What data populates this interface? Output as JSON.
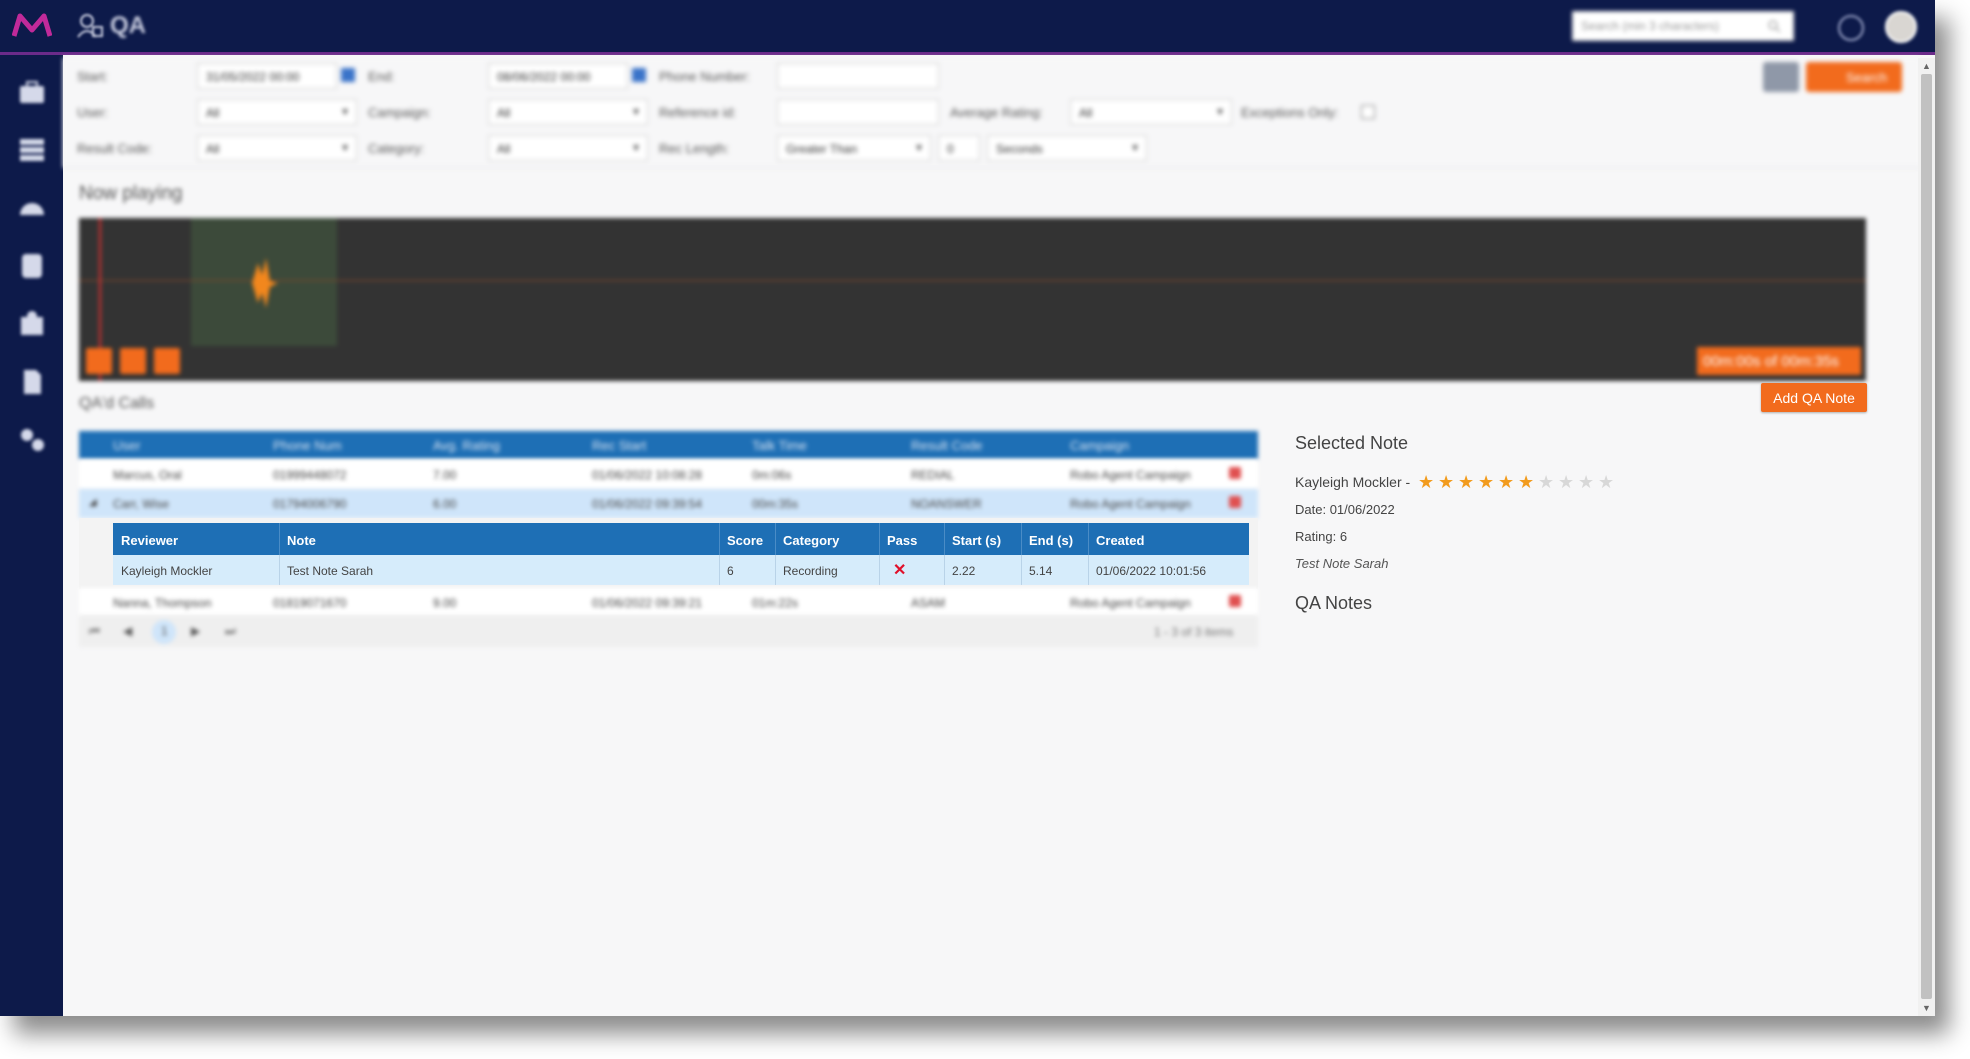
{
  "app": {
    "title": "QA"
  },
  "header": {
    "search_placeholder": "Search (min 3 characters)"
  },
  "sidebar": {
    "icons": [
      "briefcase-icon",
      "grid-icon",
      "dashboard-icon",
      "database-icon",
      "contacts-icon",
      "document-icon",
      "settings-icon"
    ]
  },
  "filters": {
    "start_label": "Start:",
    "start_value": "31/05/2022 00:00",
    "end_label": "End:",
    "end_value": "08/06/2022 00:00",
    "phone_label": "Phone Number:",
    "phone_value": "",
    "user_label": "User:",
    "user_value": "All",
    "campaign_label": "Campaign:",
    "campaign_value": "All",
    "reference_label": "Reference id:",
    "reference_value": "",
    "avg_rating_label": "Average Rating:",
    "avg_rating_value": "All",
    "exceptions_label": "Exceptions Only:",
    "result_code_label": "Result Code:",
    "result_code_value": "All",
    "category_label": "Category:",
    "category_value": "All",
    "rec_length_label": "Rec Length:",
    "rec_length_op": "Greater Than",
    "rec_length_value": "0",
    "rec_length_unit": "Seconds",
    "search_label": "Search"
  },
  "player": {
    "title": "Now playing",
    "time": "00m:00s of 00m:35s"
  },
  "add_qa_note_label": "Add QA Note",
  "calls": {
    "title": "QA'd Calls",
    "columns": [
      "User",
      "Phone Num",
      "Avg. Rating",
      "Rec Start",
      "Talk Time",
      "Result Code",
      "Campaign"
    ],
    "rows": [
      [
        "Marcus, Oral",
        "01999448072",
        "7.00",
        "01/06/2022 10:08:28",
        "0m:06s",
        "REDIAL",
        "Robo Agent Campaign"
      ],
      [
        "Carr, Wise",
        "01794006790",
        "6.00",
        "01/06/2022 09:39:54",
        "00m:35s",
        "NOANSWER",
        "Robo Agent Campaign"
      ],
      [
        "Nanna, Thompson",
        "01819071670",
        "9.00",
        "01/06/2022 09:39:21",
        "01m:22s",
        "ASAM",
        "Robo Agent Campaign"
      ]
    ],
    "detail": {
      "columns": [
        "Reviewer",
        "Note",
        "Score",
        "Category",
        "Pass",
        "Start (s)",
        "End (s)",
        "Created"
      ],
      "row": {
        "reviewer": "Kayleigh Mockler",
        "note": "Test Note Sarah",
        "score": "6",
        "category": "Recording",
        "pass": "✕",
        "start": "2.22",
        "end": "5.14",
        "created": "01/06/2022 10:01:56"
      }
    },
    "pager": {
      "current": "1",
      "info": "1 - 3 of 3 items"
    }
  },
  "selected_note": {
    "title": "Selected Note",
    "reviewer": "Kayleigh Mockler -",
    "rating_stars": 6,
    "rating_max": 10,
    "date_label": "Date:",
    "date_value": "01/06/2022",
    "rating_label": "Rating:",
    "rating_value": "6",
    "note": "Test Note Sarah"
  },
  "qa_notes_title": "QA Notes",
  "colors": {
    "nav": "#0d1a4a",
    "accent": "#f26b1d",
    "grid_header": "#1e6fb5",
    "star": "#f29b1d",
    "pass_fail": "#e0102a"
  }
}
